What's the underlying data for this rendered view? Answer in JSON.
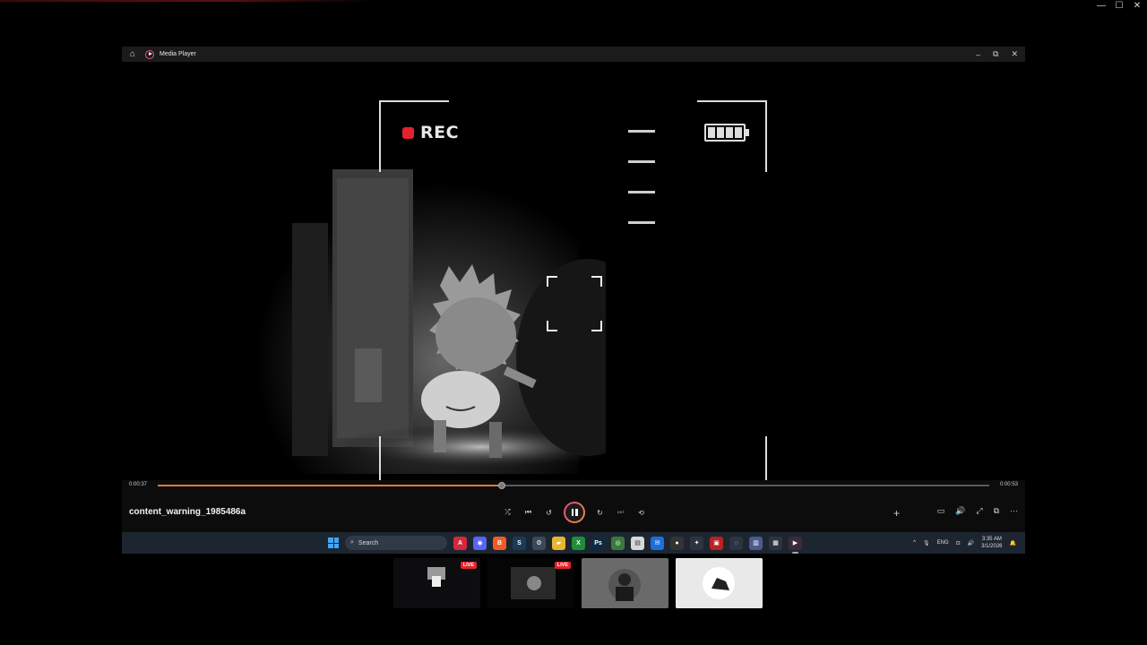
{
  "outer_window": {
    "controls": [
      "—",
      "☐",
      "✕"
    ]
  },
  "app": {
    "title": "Media Player",
    "window_controls": {
      "minimize": "–",
      "restore": "⧉",
      "close": "✕"
    }
  },
  "video": {
    "rec_label": "REC",
    "battery_cells": 4
  },
  "player": {
    "elapsed": "0:00:37",
    "duration": "0:00:53",
    "progress_fraction": 0.414,
    "file_name": "content_warning_1985486a",
    "buttons": {
      "shuffle": "⤮",
      "previous": "⏮",
      "rewind": "↺",
      "forward": "↻",
      "next": "⏭",
      "repeat": "⟲",
      "add": "+",
      "miniplayer": "▭",
      "volume": "🔊",
      "fullscreen": "⤢",
      "cast": "⧉",
      "more": "···"
    }
  },
  "taskbar": {
    "search_placeholder": "Search",
    "search_icon": "⌕",
    "apps": [
      {
        "name": "acrobat",
        "glyph": "A",
        "color": "#d4283d"
      },
      {
        "name": "discord",
        "glyph": "◉",
        "color": "#5865f2"
      },
      {
        "name": "brave",
        "glyph": "B",
        "color": "#f05a24"
      },
      {
        "name": "steam",
        "glyph": "S",
        "color": "#1b3a5a"
      },
      {
        "name": "settings",
        "glyph": "⚙",
        "color": "#3a4a5a"
      },
      {
        "name": "file-explorer",
        "glyph": "▰",
        "color": "#e8b530"
      },
      {
        "name": "xbox",
        "glyph": "X",
        "color": "#1f8e3a"
      },
      {
        "name": "photoshop",
        "glyph": "Ps",
        "color": "#0f2a44"
      },
      {
        "name": "chrome",
        "glyph": "◎",
        "color": "#3a7a3a"
      },
      {
        "name": "notepad",
        "glyph": "▤",
        "color": "#d8d8d8"
      },
      {
        "name": "mail",
        "glyph": "✉",
        "color": "#1c6fd8"
      },
      {
        "name": "obs",
        "glyph": "●",
        "color": "#333"
      },
      {
        "name": "unreal",
        "glyph": "✦",
        "color": "#2b3440"
      },
      {
        "name": "recorder",
        "glyph": "▣",
        "color": "#b82222"
      },
      {
        "name": "sync",
        "glyph": "◌",
        "color": "#2b3440"
      },
      {
        "name": "device",
        "glyph": "▥",
        "color": "#4a5a8a"
      },
      {
        "name": "gpu",
        "glyph": "▦",
        "color": "#2b3440"
      },
      {
        "name": "media-player",
        "glyph": "▶",
        "color": "#3b2a3a"
      }
    ],
    "tray": {
      "chevron": "^",
      "mic": "🎙",
      "language": "ENG",
      "network": "⊡",
      "volume": "🔊",
      "time": "3:35 AM",
      "date": "3/1/2026",
      "notifications": "🔔"
    }
  },
  "thumbnails": [
    {
      "label": "LIVE"
    },
    {
      "label": "LIVE"
    },
    {
      "label": ""
    },
    {
      "label": ""
    }
  ]
}
